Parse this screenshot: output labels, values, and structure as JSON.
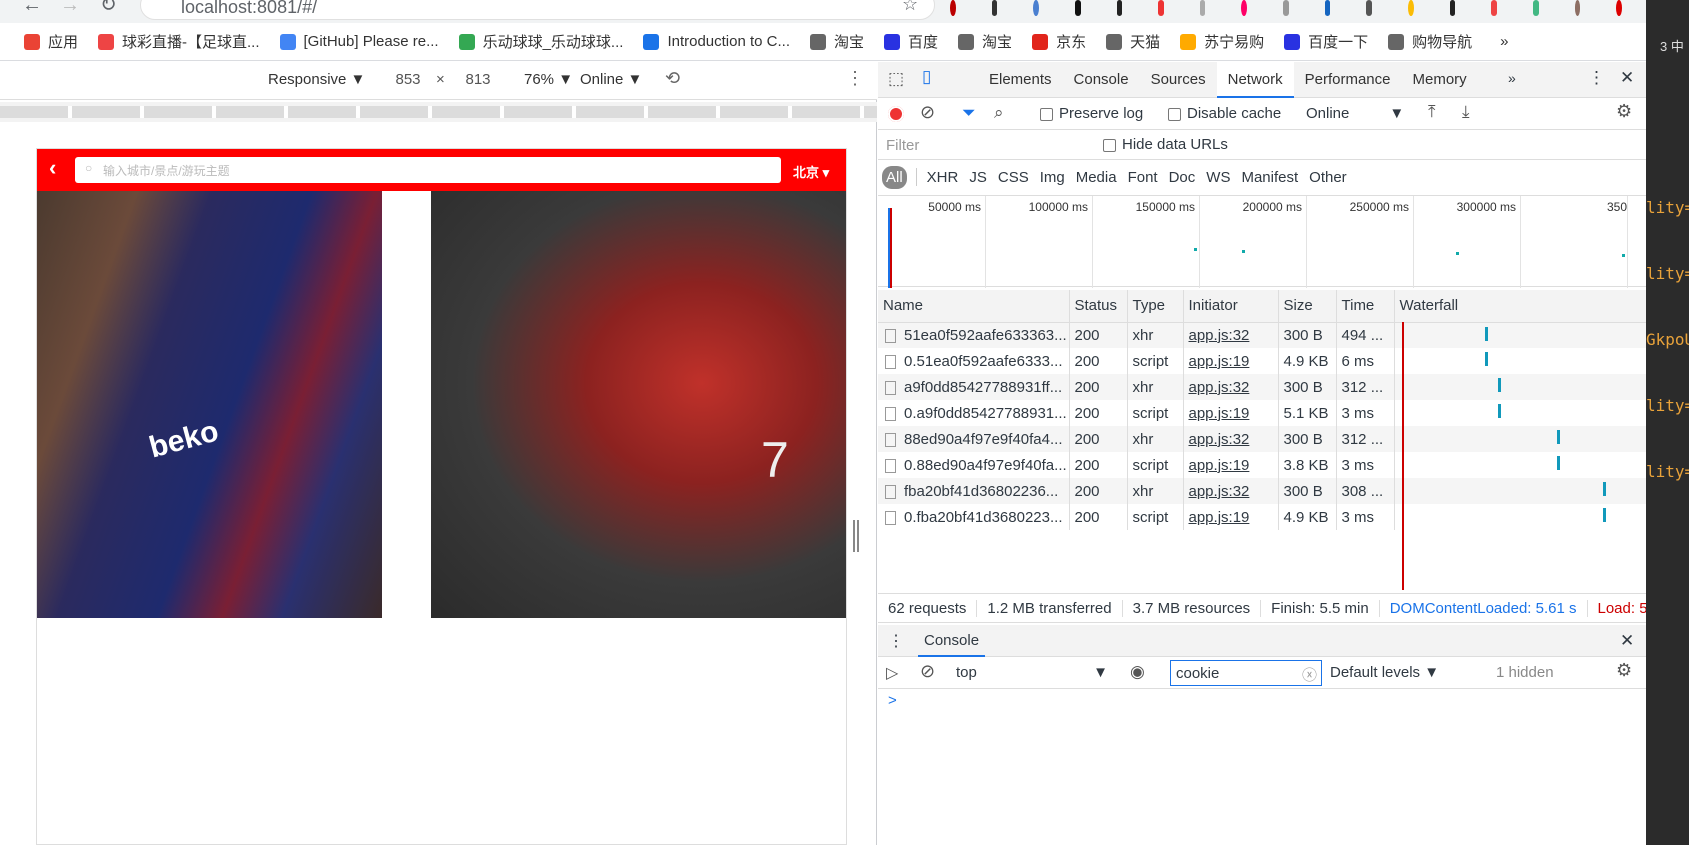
{
  "browser": {
    "url": "localhost:8081/#/",
    "tab_count": "3 中"
  },
  "bookmarks": [
    {
      "label": "应用",
      "color": "#ea4335"
    },
    {
      "label": "球彩直播-【足球直...",
      "color": "#e44"
    },
    {
      "label": "[GitHub] Please re...",
      "color": "#4285f4"
    },
    {
      "label": "乐动球球_乐动球球...",
      "color": "#34a853"
    },
    {
      "label": "Introduction to C...",
      "color": "#1a73e8"
    },
    {
      "label": "淘宝",
      "color": "#666"
    },
    {
      "label": "百度",
      "color": "#2932e1"
    },
    {
      "label": "淘宝",
      "color": "#666"
    },
    {
      "label": "京东",
      "color": "#e1251b"
    },
    {
      "label": "天猫",
      "color": "#666"
    },
    {
      "label": "苏宁易购",
      "color": "#ffaa00"
    },
    {
      "label": "百度一下",
      "color": "#2932e1"
    },
    {
      "label": "购物导航",
      "color": "#666"
    }
  ],
  "devtoolbar": {
    "mode": "Responsive",
    "width": "853",
    "height": "813",
    "zoom": "76%",
    "network": "Online"
  },
  "app": {
    "search_placeholder": "输入城市/景点/游玩主题",
    "city": "北京"
  },
  "devtools": {
    "tabs": [
      "Elements",
      "Console",
      "Sources",
      "Network",
      "Performance",
      "Memory"
    ],
    "active_tab": "Network",
    "preserve_log": "Preserve log",
    "disable_cache": "Disable cache",
    "throttle": "Online",
    "filter_placeholder": "Filter",
    "hide_data_urls": "Hide data URLs",
    "types": [
      "All",
      "XHR",
      "JS",
      "CSS",
      "Img",
      "Media",
      "Font",
      "Doc",
      "WS",
      "Manifest",
      "Other"
    ],
    "timeline_ticks": [
      "50000 ms",
      "100000 ms",
      "150000 ms",
      "200000 ms",
      "250000 ms",
      "300000 ms",
      "350"
    ],
    "columns": [
      "Name",
      "Status",
      "Type",
      "Initiator",
      "Size",
      "Time",
      "Waterfall"
    ],
    "rows": [
      {
        "name": "51ea0f592aafe633363...",
        "status": "200",
        "type": "xhr",
        "initiator": "app.js:32",
        "size": "300 B",
        "time": "494 ..."
      },
      {
        "name": "0.51ea0f592aafe6333...",
        "status": "200",
        "type": "script",
        "initiator": "app.js:19",
        "size": "4.9 KB",
        "time": "6 ms"
      },
      {
        "name": "a9f0dd85427788931ff...",
        "status": "200",
        "type": "xhr",
        "initiator": "app.js:32",
        "size": "300 B",
        "time": "312 ..."
      },
      {
        "name": "0.a9f0dd85427788931...",
        "status": "200",
        "type": "script",
        "initiator": "app.js:19",
        "size": "5.1 KB",
        "time": "3 ms"
      },
      {
        "name": "88ed90a4f97e9f40fa4...",
        "status": "200",
        "type": "xhr",
        "initiator": "app.js:32",
        "size": "300 B",
        "time": "312 ..."
      },
      {
        "name": "0.88ed90a4f97e9f40fa...",
        "status": "200",
        "type": "script",
        "initiator": "app.js:19",
        "size": "3.8 KB",
        "time": "3 ms"
      },
      {
        "name": "fba20bf41d36802236...",
        "status": "200",
        "type": "xhr",
        "initiator": "app.js:32",
        "size": "300 B",
        "time": "308 ..."
      },
      {
        "name": "0.fba20bf41d3680223...",
        "status": "200",
        "type": "script",
        "initiator": "app.js:19",
        "size": "4.9 KB",
        "time": "3 ms"
      }
    ],
    "summary": {
      "requests": "62 requests",
      "transferred": "1.2 MB transferred",
      "resources": "3.7 MB resources",
      "finish": "Finish: 5.5 min",
      "dcl": "DOMContentLoaded: 5.61 s",
      "load": "Load: 5"
    },
    "console": {
      "title": "Console",
      "context": "top",
      "filter": "cookie",
      "levels": "Default levels",
      "hidden": "1 hidden",
      "prompt": ">"
    }
  },
  "editor_snippets": [
    "lity=",
    "lity=",
    "GkpoU",
    "lity=",
    "lity="
  ]
}
